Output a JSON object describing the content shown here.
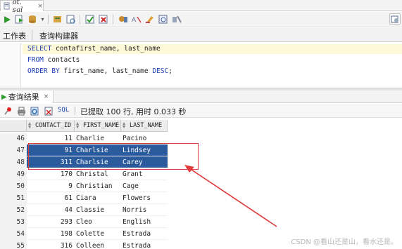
{
  "tabs": {
    "file_tab": "ot. sql",
    "close": "×"
  },
  "toolbar": {
    "icons": [
      "run-icon",
      "run-script-icon",
      "commit-icon",
      "rollback-icon",
      "explain-icon",
      "autotrace-icon",
      "sql-tuning-icon",
      "clear-icon",
      "history-icon",
      "format-icon"
    ]
  },
  "editor_tabs": {
    "worksheet": "工作表",
    "query_builder": "查询构建器"
  },
  "editor": {
    "line1": {
      "keyword": "SELECT",
      "rest": " contafirst_name, last_name"
    },
    "line2": {
      "keyword": "FROM",
      "rest": " contacts"
    },
    "line3": {
      "keyword": "ORDER BY",
      "rest": " first_name, last_name ",
      "keyword2": "DESC",
      "end": ";"
    }
  },
  "results": {
    "tab_label": "查询结果",
    "close": "×",
    "sql_link": "SQL",
    "status": "已提取 100 行, 用时 0.033 秒",
    "columns": [
      "CONTACT_ID",
      "FIRST_NAME",
      "LAST_NAME"
    ],
    "rows": [
      {
        "n": "46",
        "id": "11",
        "first": "Charlie",
        "last": "Pacino"
      },
      {
        "n": "47",
        "id": "91",
        "first": "Charlsie",
        "last": "Lindsey"
      },
      {
        "n": "48",
        "id": "311",
        "first": "Charlsie",
        "last": "Carey"
      },
      {
        "n": "49",
        "id": "170",
        "first": "Christal",
        "last": "Grant"
      },
      {
        "n": "50",
        "id": "9",
        "first": "Christian",
        "last": "Cage"
      },
      {
        "n": "51",
        "id": "61",
        "first": "Ciara",
        "last": "Flowers"
      },
      {
        "n": "52",
        "id": "44",
        "first": "Classie",
        "last": "Norris"
      },
      {
        "n": "53",
        "id": "293",
        "first": "Cleo",
        "last": "English"
      },
      {
        "n": "54",
        "id": "198",
        "first": "Colette",
        "last": "Estrada"
      },
      {
        "n": "55",
        "id": "316",
        "first": "Colleen",
        "last": "Estrada"
      }
    ]
  },
  "watermark": "CSDN @看山还是山，看水还是。",
  "colors": {
    "selection": "#2b5b9c",
    "annotation": "#e23a3a",
    "keyword": "#1a3fb5"
  }
}
